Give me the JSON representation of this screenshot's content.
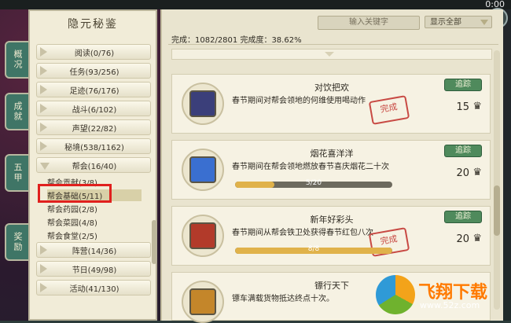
{
  "clock": "0:00",
  "top_close": "✕",
  "tabs": [
    "概况",
    "成就",
    "五甲",
    "奖励"
  ],
  "panel_title": "隐元秘鉴",
  "categories": [
    {
      "label": "阅读(0/76)"
    },
    {
      "label": "任务(93/256)"
    },
    {
      "label": "足迹(76/176)"
    },
    {
      "label": "战斗(6/102)"
    },
    {
      "label": "声望(22/82)"
    },
    {
      "label": "秘境(538/1162)"
    },
    {
      "label": "帮会(16/40)"
    }
  ],
  "subcategories": [
    {
      "label": "帮会贡献(3/8)"
    },
    {
      "label": "帮会基础(5/11)"
    },
    {
      "label": "帮会药园(2/8)"
    },
    {
      "label": "帮会菜园(4/8)"
    },
    {
      "label": "帮会食堂(2/5)"
    }
  ],
  "categories_bottom": [
    {
      "label": "阵营(14/36)"
    },
    {
      "label": "节日(49/98)"
    },
    {
      "label": "活动(41/130)"
    }
  ],
  "search": {
    "placeholder": "输入关键字"
  },
  "filter": {
    "value": "显示全部"
  },
  "progress_text": "完成：1082/2801 完成度：38.62%",
  "cards": [
    {
      "title": "对饮把欢",
      "desc": "春节期间对帮会领地的何维使用喝动作",
      "track": "追踪",
      "reward": "15",
      "stamp": "完成",
      "progress": null,
      "icon_color": "#3b3f7a"
    },
    {
      "title": "烟花喜洋洋",
      "desc": "春节期间在帮会领地燃放春节喜庆烟花二十次",
      "track": "追踪",
      "reward": "20",
      "stamp": null,
      "progress": {
        "text": "5/20",
        "value": 0.25
      },
      "icon_color": "#3a6fd0"
    },
    {
      "title": "新年好彩头",
      "desc": "春节期间从帮会铁卫处获得春节红包八次",
      "track": "追踪",
      "reward": "20",
      "stamp": "完成",
      "progress": {
        "text": "8/8",
        "value": 1.0
      },
      "icon_color": "#b23a2a"
    },
    {
      "title": "镖行天下",
      "desc": "镖车满载货物抵达终点十次。",
      "track": null,
      "reward": null,
      "stamp": null,
      "progress": null,
      "icon_color": "#c4862a"
    }
  ],
  "watermark": {
    "text": "飞翔下载",
    "url": "www.52z.com"
  }
}
